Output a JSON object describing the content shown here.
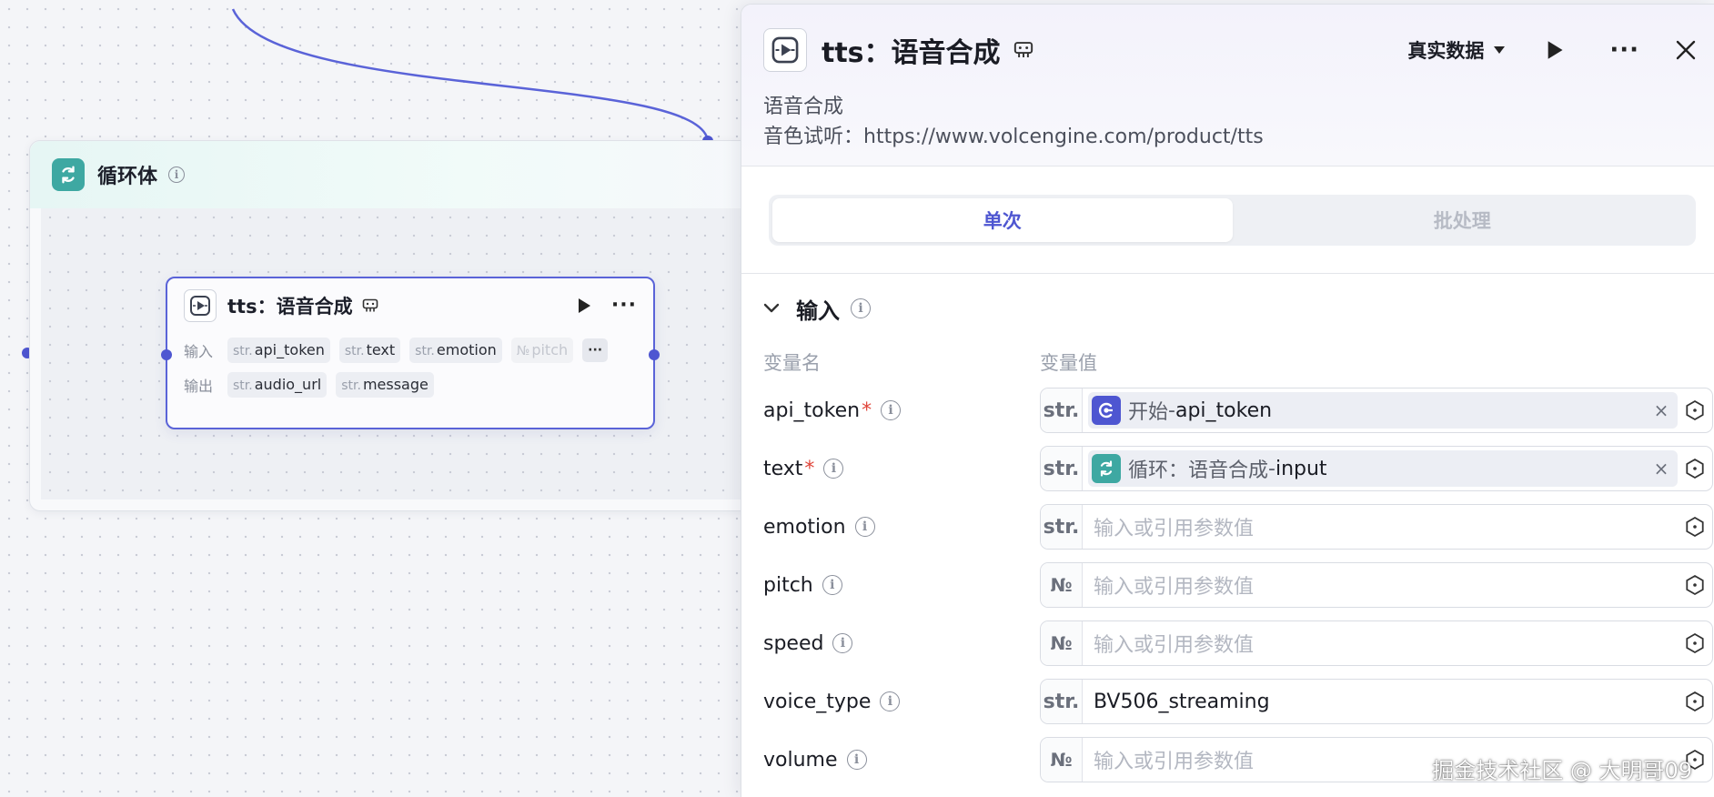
{
  "loop_node": {
    "title": "循环体"
  },
  "tts_node": {
    "title": "tts：语音合成",
    "input_label": "输入",
    "output_label": "输出",
    "inputs": [
      {
        "type": "str.",
        "name": "api_token"
      },
      {
        "type": "str.",
        "name": "text"
      },
      {
        "type": "str.",
        "name": "emotion"
      },
      {
        "type": "№",
        "name": "pitch"
      }
    ],
    "outputs": [
      {
        "type": "str.",
        "name": "audio_url"
      },
      {
        "type": "str.",
        "name": "message"
      }
    ],
    "more_inputs": "···"
  },
  "panel": {
    "title": "tts：语音合成",
    "data_mode": "真实数据",
    "description_line1": "语音合成",
    "description_line2": "音色试听：https://www.volcengine.com/product/tts",
    "tabs": [
      {
        "label": "单次",
        "active": true
      },
      {
        "label": "批处理",
        "active": false
      }
    ],
    "section_title": "输入",
    "col_name": "变量名",
    "col_value": "变量值",
    "params": [
      {
        "name": "api_token",
        "required": "*",
        "type": "str.",
        "ref_source": "开始",
        "ref_sep": " - ",
        "ref_var": "api_token",
        "ref_icon": "start-node-icon",
        "clear": "×"
      },
      {
        "name": "text",
        "required": "*",
        "type": "str.",
        "ref_source": "循环：语音合成",
        "ref_sep": " - ",
        "ref_var": "input",
        "ref_icon": "loop-icon",
        "clear": "×"
      },
      {
        "name": "emotion",
        "type": "str.",
        "placeholder": "输入或引用参数值"
      },
      {
        "name": "pitch",
        "type": "№",
        "placeholder": "输入或引用参数值"
      },
      {
        "name": "speed",
        "type": "№",
        "placeholder": "输入或引用参数值"
      },
      {
        "name": "voice_type",
        "type": "str.",
        "value": "BV506_streaming"
      },
      {
        "name": "volume",
        "type": "№",
        "placeholder": "输入或引用参数值"
      }
    ]
  },
  "watermark": "掘金技术社区 @ 大明哥09",
  "colors": {
    "accent": "#4e56d1",
    "loop": "#3ea8a2",
    "required": "#e0453a"
  }
}
